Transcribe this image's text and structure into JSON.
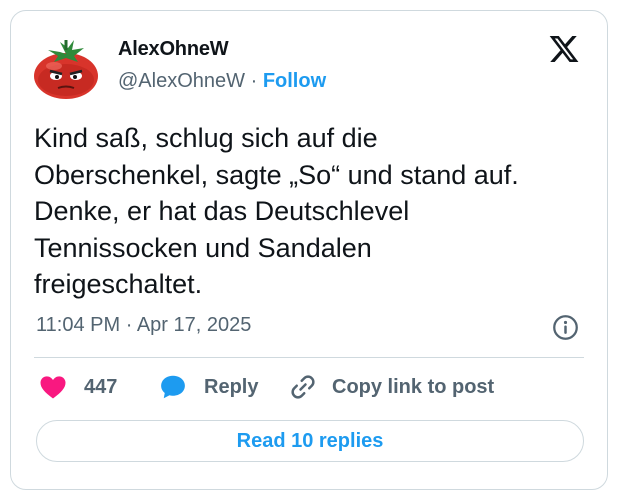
{
  "author": {
    "name": "AlexOhneW",
    "handle": "@AlexOhneW",
    "separator": "·",
    "follow_label": "Follow"
  },
  "tweet": {
    "lines": [
      "Kind saß, schlug sich auf die",
      "Oberschenkel, sagte „So“ und stand auf.",
      "Denke, er hat das Deutschlevel",
      "Tennissocken und Sandalen",
      "freigeschaltet."
    ],
    "time": "11:04 PM",
    "date_separator": "·",
    "date": "Apr 17, 2025"
  },
  "actions": {
    "like_count": "447",
    "reply_label": "Reply",
    "copy_label": "Copy link to post"
  },
  "read_replies_label": "Read 10 replies",
  "colors": {
    "accent": "#1d9bf0",
    "heart": "#f91880",
    "muted": "#536471",
    "text": "#0f1419",
    "border": "#cfd9de"
  },
  "icons": [
    "tomato-avatar",
    "x-logo-icon",
    "info-icon",
    "heart-icon",
    "reply-bubble-icon",
    "link-icon"
  ]
}
